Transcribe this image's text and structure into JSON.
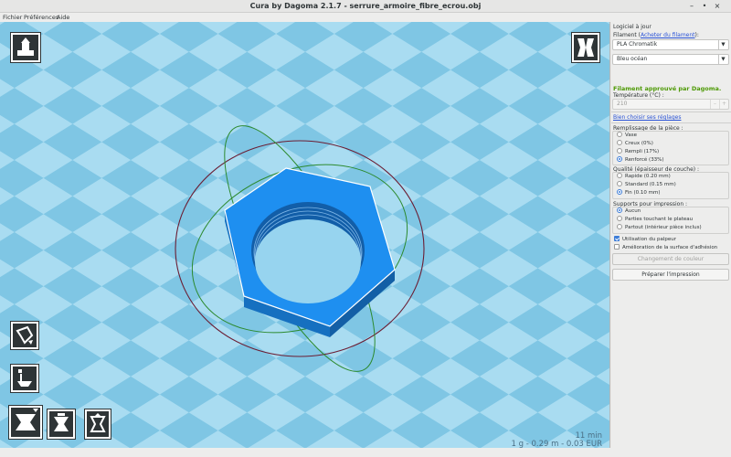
{
  "window": {
    "title": "Cura by Dagoma 2.1.7 - serrure_armoire_fibre_ecrou.obj",
    "minimize": "–",
    "maximize": "•",
    "close": "×"
  },
  "menubar": {
    "items": [
      "Fichier",
      "Préférences",
      "Aide"
    ]
  },
  "viewport": {
    "colors": {
      "floor_light": "#a9dcf1",
      "floor_dark": "#7fc6e4",
      "model_top": "#1e8ff0",
      "model_side": "#1670c0"
    },
    "tools_top": [
      {
        "name": "load-model-icon"
      },
      {
        "name": "view-mode-icon"
      }
    ],
    "tools_bottom": [
      {
        "name": "rotate-icon"
      },
      {
        "name": "scale-icon"
      },
      {
        "name": "mirror-icon"
      },
      {
        "name": "lay-flat-icon"
      },
      {
        "name": "reset-icon"
      }
    ],
    "stats": {
      "time": "11 min",
      "material": "1 g - 0.29 m - 0.03 EUR"
    }
  },
  "panel": {
    "update": "Logiciel à jour",
    "filament_label": "Filament (",
    "filament_link": "Acheter du filament",
    "filament_label_end": "):",
    "filament_value": "PLA Chromatik",
    "color_value": "Bleu océan",
    "approved": "Filament approuvé par Dagoma.",
    "temperature_label": "Température (°C) :",
    "temperature_value": "210",
    "temp_minus": "–",
    "temp_plus": "+",
    "settings_link": "Bien choisir ses réglages",
    "infill": {
      "title": "Remplissage de la pièce :",
      "options": [
        "Vase",
        "Creux (0%)",
        "Rempli (17%)",
        "Renforcé (33%)"
      ],
      "selected": 3
    },
    "quality": {
      "title": "Qualité (épaisseur de couche) :",
      "options": [
        "Rapide (0.20 mm)",
        "Standard (0.15 mm)",
        "Fin (0.10 mm)"
      ],
      "selected": 2
    },
    "supports": {
      "title": "Supports pour impression :",
      "options": [
        "Aucun",
        "Parties touchant le plateau",
        "Partout (intérieur pièce inclus)"
      ],
      "selected": 0
    },
    "checks": [
      {
        "label": "Utilisation du palpeur",
        "checked": true
      },
      {
        "label": "Amélioration de la surface d'adhésion",
        "checked": false
      }
    ],
    "color_change_button": "Changement de couleur",
    "prepare_button": "Préparer l'impression"
  }
}
